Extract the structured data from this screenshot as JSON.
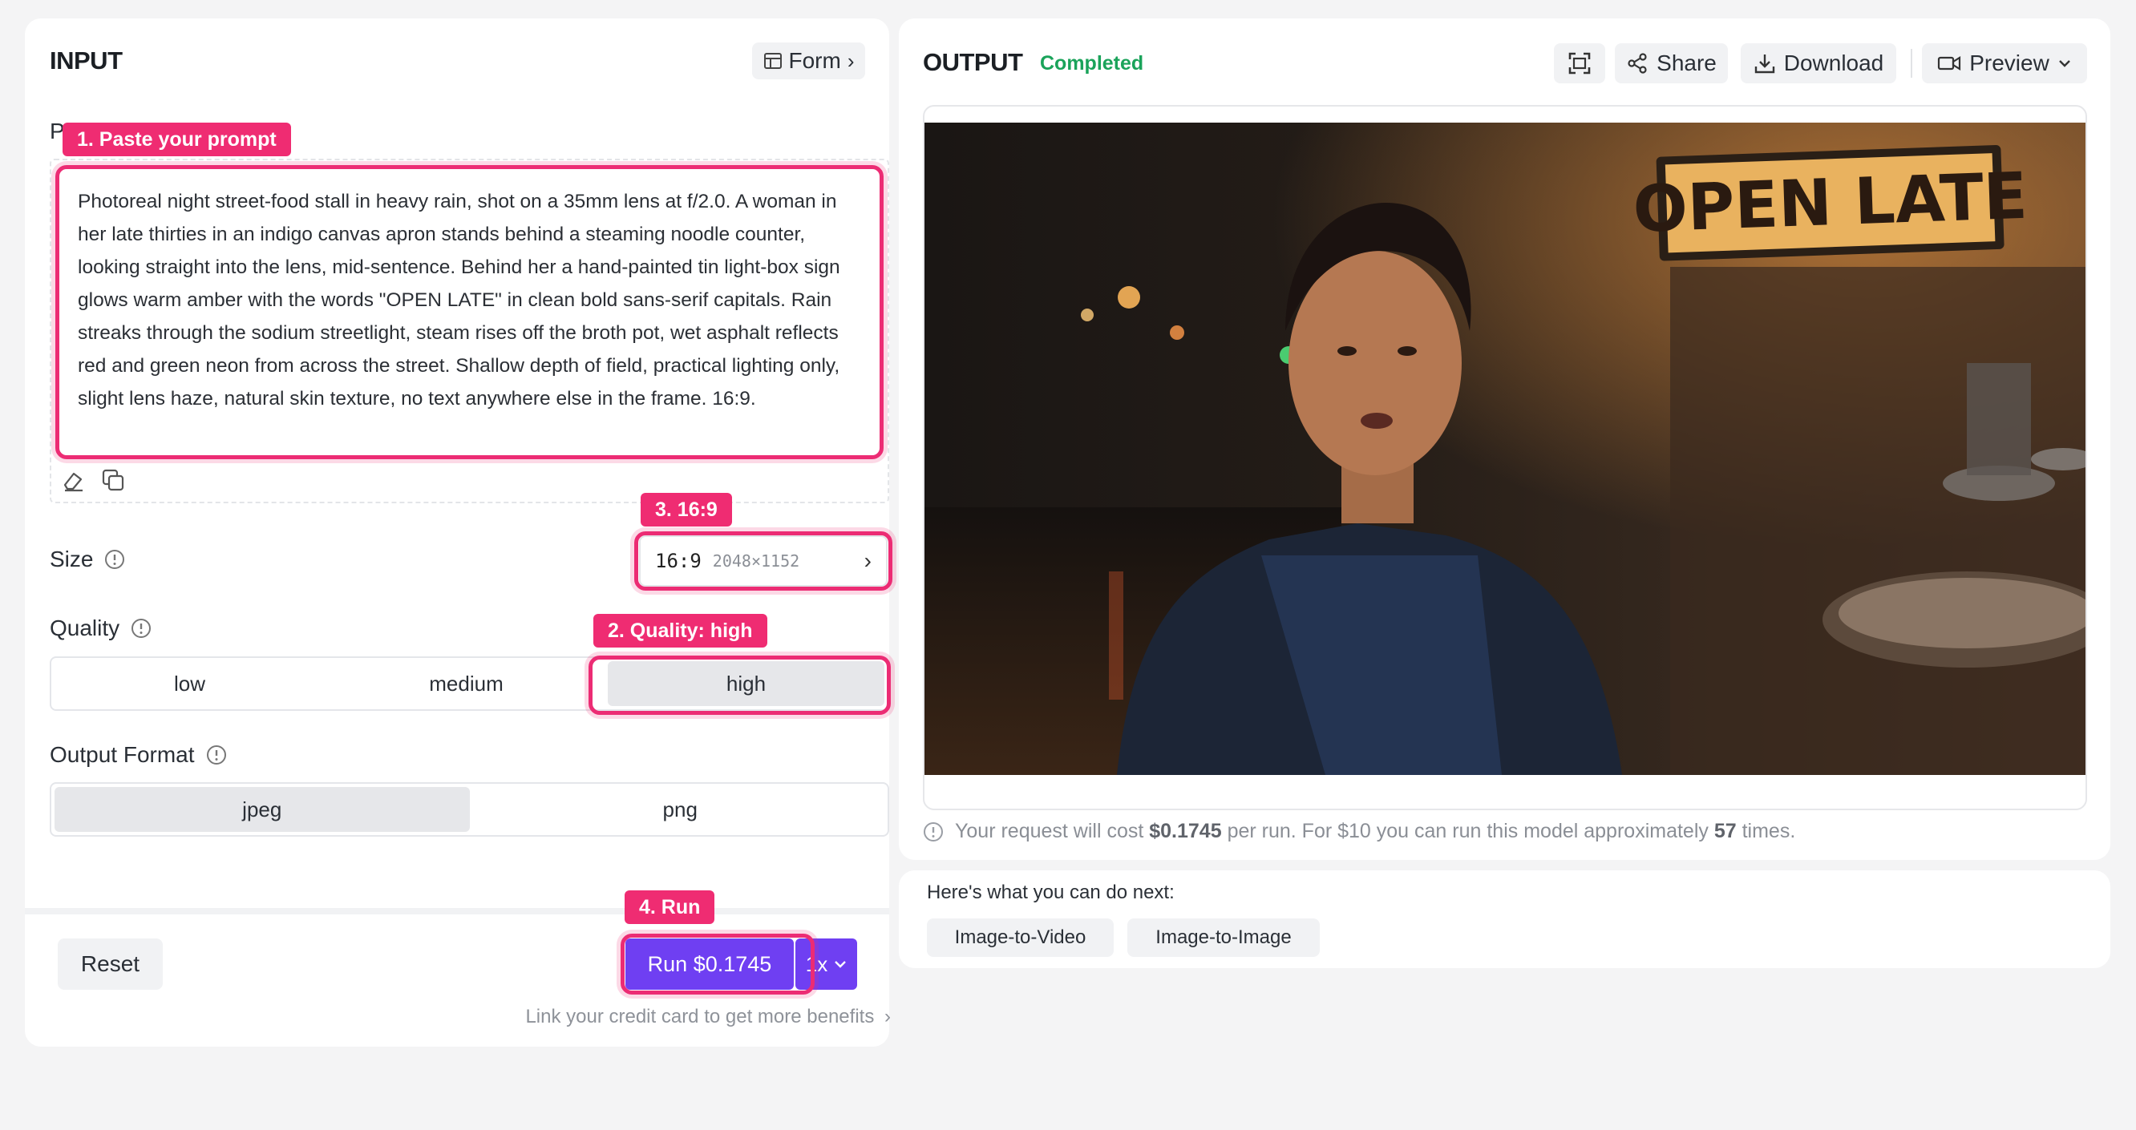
{
  "input": {
    "title": "INPUT",
    "form_button": "Form",
    "prompt_label": "P",
    "prompt_text": "Photoreal night street-food stall in heavy rain, shot on a 35mm lens at f/2.0. A woman in her late thirties in an indigo canvas apron stands behind a steaming noodle counter, looking straight into the lens, mid-sentence. Behind her a hand-painted tin light-box sign glows warm amber with the words \"OPEN LATE\" in clean bold sans-serif capitals. Rain streaks through the sodium streetlight, steam rises off the broth pot, wet asphalt reflects red and green neon from across the street. Shallow depth of field, practical lighting only, slight lens haze, natural skin texture, no text anywhere else in the frame. 16:9.",
    "size_label": "Size",
    "size_value": "16:9",
    "size_dims": "2048×1152",
    "quality_label": "Quality",
    "quality_options": [
      "low",
      "medium",
      "high"
    ],
    "quality_selected": "high",
    "format_label": "Output Format",
    "format_options": [
      "jpeg",
      "png"
    ],
    "format_selected": "jpeg",
    "reset_button": "Reset",
    "run_button": "Run $0.1745",
    "run_multiplier": "1x",
    "credit_link": "Link your credit card to get more benefits"
  },
  "annotations": {
    "step1": "1. Paste your prompt",
    "step2": "2. Quality: high",
    "step3": "3. 16:9",
    "step4": "4. Run"
  },
  "output": {
    "title": "OUTPUT",
    "status": "Completed",
    "share_button": "Share",
    "download_button": "Download",
    "preview_button": "Preview",
    "sign_text": "OPEN LATE",
    "cost_prefix": "Your request will cost ",
    "cost_value": "$0.1745",
    "cost_mid": " per run. For $10 you can run this model approximately ",
    "cost_times": "57",
    "cost_suffix": " times."
  },
  "next": {
    "heading": "Here's what you can do next:",
    "actions": [
      "Image-to-Video",
      "Image-to-Image"
    ]
  },
  "colors": {
    "accent_pink": "#ec2c74",
    "run_purple": "#6f3ff2",
    "status_green": "#1aa35a"
  }
}
